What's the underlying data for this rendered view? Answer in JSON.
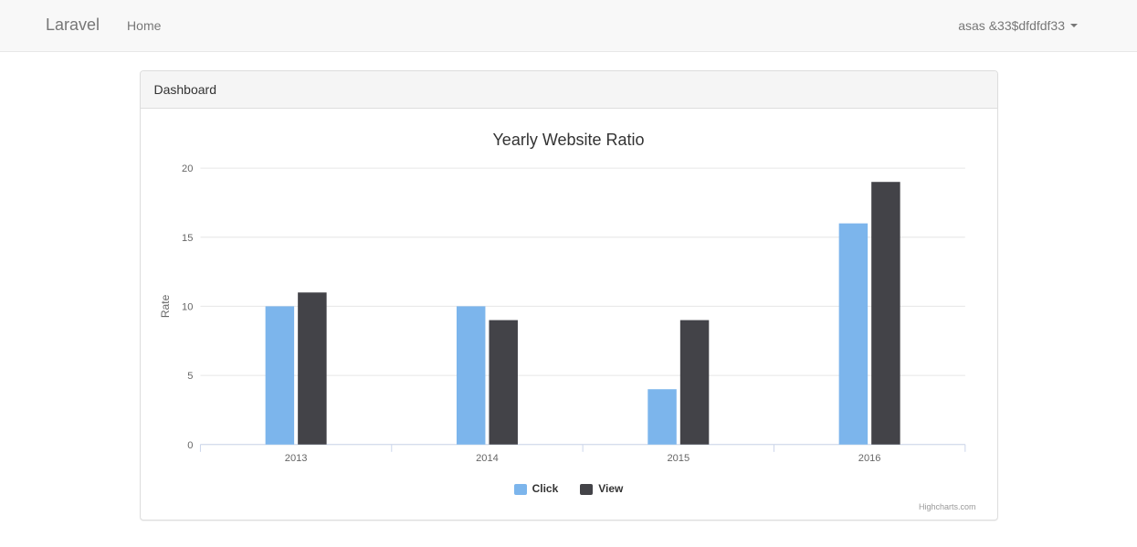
{
  "navbar": {
    "brand": "Laravel",
    "home": "Home",
    "user": "asas &33$dfdfdf33"
  },
  "panel": {
    "heading": "Dashboard"
  },
  "chart_data": {
    "type": "bar",
    "title": "Yearly Website Ratio",
    "categories": [
      "2013",
      "2014",
      "2015",
      "2016"
    ],
    "series": [
      {
        "name": "Click",
        "values": [
          10,
          10,
          4,
          16
        ],
        "color": "#7cb5ec"
      },
      {
        "name": "View",
        "values": [
          11,
          9,
          9,
          19
        ],
        "color": "#434348"
      }
    ],
    "ylabel": "Rate",
    "xlabel": "",
    "ylim": [
      0,
      20
    ],
    "yticks": [
      0,
      5,
      10,
      15,
      20
    ],
    "credits": "Highcharts.com"
  }
}
